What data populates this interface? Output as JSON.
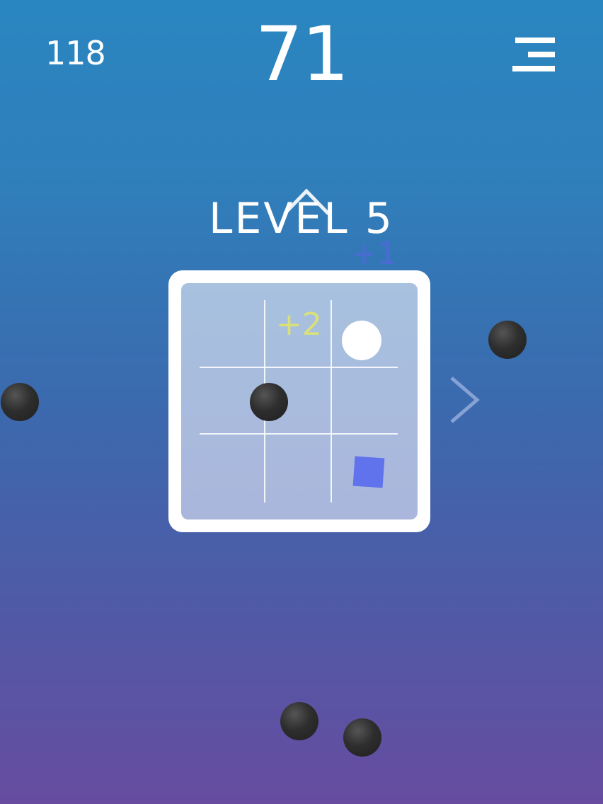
{
  "hud": {
    "best_score": "118",
    "score": "71",
    "menu_icon": "hamburger-menu-icon"
  },
  "level": {
    "title": "LEVEL 5",
    "up_icon": "chevron-up-icon",
    "next_icon": "chevron-right-icon"
  },
  "bonuses": {
    "floating_bonus": "+1",
    "board_bonus": "+2"
  },
  "board": {
    "rows": 3,
    "cols": 3,
    "player_cell": [
      0,
      2
    ],
    "obstacle_cell": [
      1,
      1
    ],
    "target_cell": [
      2,
      2
    ]
  },
  "colors": {
    "background_top": "#2a86c0",
    "background_bottom": "#674ca0",
    "board_frame": "#ffffff",
    "board_fill": "#a7c1df",
    "plus_one": "#5b63e8",
    "plus_two": "#d9e07a",
    "target": "#6072ec",
    "ball": "#2e2e2e",
    "player": "#ffffff"
  }
}
